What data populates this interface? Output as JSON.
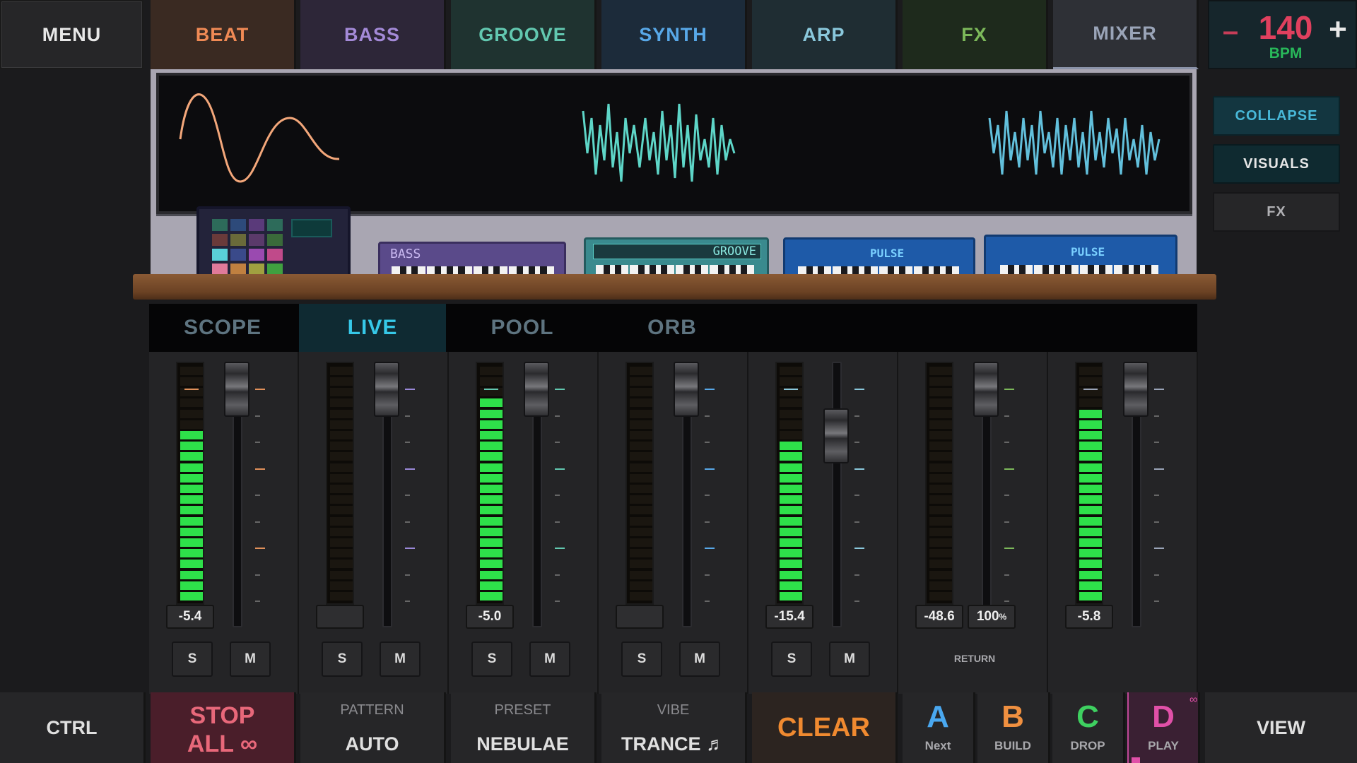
{
  "topbar": {
    "menu": "MENU",
    "tabs": [
      {
        "label": "BEAT",
        "color": "#f08a55"
      },
      {
        "label": "BASS",
        "color": "#a48ad8"
      },
      {
        "label": "GROOVE",
        "color": "#62c8b0"
      },
      {
        "label": "SYNTH",
        "color": "#58a8e8"
      },
      {
        "label": "ARP",
        "color": "#8ac8dc"
      },
      {
        "label": "FX",
        "color": "#7cb85a"
      },
      {
        "label": "MIXER",
        "color": "#9aa4b8"
      }
    ],
    "tempo": {
      "minus": "–",
      "value": "140",
      "unit": "BPM",
      "plus": "+"
    }
  },
  "side_buttons": {
    "collapse": "COLLAPSE",
    "visuals": "VISUALS",
    "fx": "FX"
  },
  "instruments": {
    "bass_label": "BASS",
    "groove_label": "GROOVE",
    "pulse_label_1": "PULSE",
    "pulse_label_2": "PULSE"
  },
  "view_tabs": {
    "items": [
      "SCOPE",
      "LIVE",
      "POOL",
      "ORB"
    ],
    "active": "LIVE"
  },
  "mixer": {
    "channels": [
      {
        "level": 0.72,
        "readout": "-5.4",
        "solo": "S",
        "mute": "M",
        "accent": "#e0905a"
      },
      {
        "level": 0.0,
        "readout": "",
        "solo": "S",
        "mute": "M",
        "accent": "#9a88d8"
      },
      {
        "level": 0.86,
        "readout": "-5.0",
        "solo": "S",
        "mute": "M",
        "accent": "#62c8b0"
      },
      {
        "level": 0.0,
        "readout": "",
        "solo": "S",
        "mute": "M",
        "accent": "#58a8e8"
      },
      {
        "level": 0.68,
        "readout": "-15.4",
        "solo": "S",
        "mute": "M",
        "accent": "#8ac8dc"
      },
      {
        "level": 0.0,
        "readout": "-48.6",
        "readout2": "100",
        "readout2_unit": "%",
        "label": "RETURN",
        "accent": "#7cb85a"
      },
      {
        "level": 0.82,
        "readout": "-5.8",
        "accent": "#9aa4b8"
      }
    ]
  },
  "bottombar": {
    "ctrl": "CTRL",
    "stop": "STOP",
    "stop2": "ALL ∞",
    "pattern_cap": "PATTERN",
    "pattern_val": "AUTO",
    "preset_cap": "PRESET",
    "preset_val": "NEBULAE",
    "vibe_cap": "VIBE",
    "vibe_val": "TRANCE ♬",
    "clear": "CLEAR",
    "sections": [
      {
        "letter": "A",
        "name": "Next",
        "color": "#4aa8f0"
      },
      {
        "letter": "B",
        "name": "BUILD",
        "color": "#f09040"
      },
      {
        "letter": "C",
        "name": "DROP",
        "color": "#3ed060"
      },
      {
        "letter": "D",
        "name": "PLAY",
        "color": "#e050a8"
      }
    ],
    "view": "VIEW"
  }
}
